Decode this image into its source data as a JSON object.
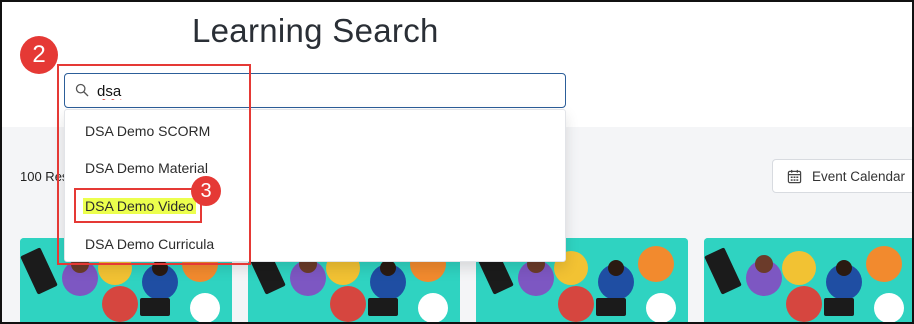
{
  "header": {
    "title": "Learning Search"
  },
  "search": {
    "value": "dsa",
    "placeholder": ""
  },
  "dropdown": {
    "items": [
      {
        "label": "DSA Demo SCORM"
      },
      {
        "label": "DSA Demo Material"
      },
      {
        "label": "DSA Demo Video",
        "highlighted": true
      },
      {
        "label": "DSA Demo Curricula"
      }
    ]
  },
  "results": {
    "count_text": "100 Res"
  },
  "toolbar": {
    "event_calendar_label": "Event Calendar"
  },
  "annotations": {
    "step_a": "2",
    "step_b": "3"
  },
  "colors": {
    "accent_red": "#e53935",
    "search_border": "#2c5e99",
    "highlight": "#ecff4d",
    "card_teal": "#2fd3c1"
  },
  "icons": {
    "search": "search-icon",
    "calendar": "calendar-icon"
  }
}
